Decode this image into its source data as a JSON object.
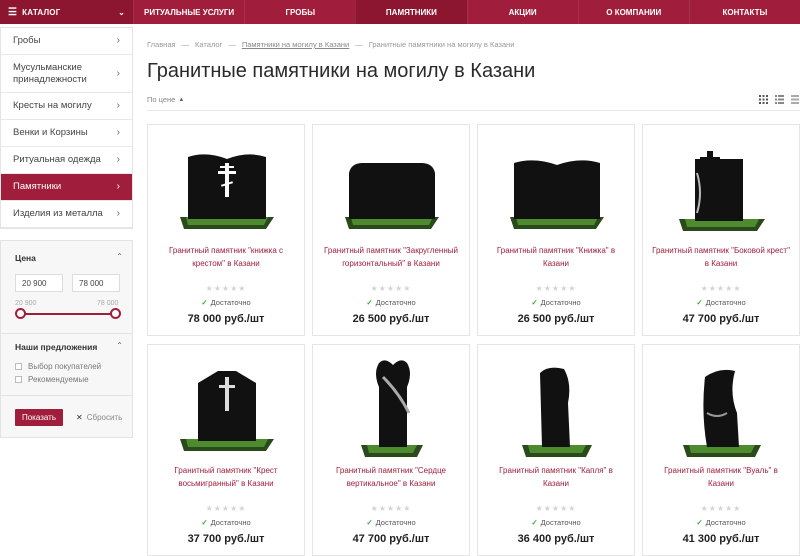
{
  "topbar": {
    "catalog_label": "КАТАЛОГ",
    "nav": [
      "РИТУАЛЬНЫЕ УСЛУГИ",
      "ГРОБЫ",
      "ПАМЯТНИКИ",
      "АКЦИИ",
      "О КОМПАНИИ",
      "КОНТАКТЫ"
    ],
    "active": "ПАМЯТНИКИ"
  },
  "sidebar": {
    "items": [
      "Гробы",
      "Мусульманские принадлежности",
      "Кресты на могилу",
      "Венки и Корзины",
      "Ритуальная одежда",
      "Памятники",
      "Изделия из металла"
    ],
    "active": "Памятники"
  },
  "filter": {
    "price_title": "Цена",
    "min_value": "20 900",
    "max_value": "78 000",
    "range_min": "20 900",
    "range_max": "78 000",
    "offers_title": "Наши предложения",
    "checkboxes": [
      "Выбор покупателей",
      "Рекомендуемые"
    ],
    "show_label": "Показать",
    "reset_label": "Сбросить"
  },
  "breadcrumb": [
    "Главная",
    "Каталог",
    "Памятники на могилу в Казани",
    "Гранитные памятники на могилу в Казани"
  ],
  "page_title": "Гранитные памятники на могилу в Казани",
  "sort_label": "По цене",
  "products": [
    {
      "name": "Гранитный памятник \"книжка с крестом\" в Казани",
      "stock": "Достаточно",
      "price": "78 000 руб./шт",
      "shape": "book-cross"
    },
    {
      "name": "Гранитный памятник \"Закругленный горизонтальный\" в Казани",
      "stock": "Достаточно",
      "price": "26 500 руб./шт",
      "shape": "rounded"
    },
    {
      "name": "Гранитный памятник \"Книжка\" в Казани",
      "stock": "Достаточно",
      "price": "26 500 руб./шт",
      "shape": "book"
    },
    {
      "name": "Гранитный памятник \"Боковой крест\" в Казани",
      "stock": "Достаточно",
      "price": "47 700 руб./шт",
      "shape": "side-cross"
    },
    {
      "name": "Гранитный памятник \"Крест восьмигранный\" в Казани",
      "stock": "Достаточно",
      "price": "37 700 руб./шт",
      "shape": "octagon"
    },
    {
      "name": "Гранитный памятник \"Сердце вертикальное\" в Казани",
      "stock": "Достаточно",
      "price": "47 700 руб./шт",
      "shape": "heart"
    },
    {
      "name": "Гранитный памятник \"Капля\" в Казани",
      "stock": "Достаточно",
      "price": "36 400 руб./шт",
      "shape": "drop"
    },
    {
      "name": "Гранитный памятник \"Вуаль\" в Казани",
      "stock": "Достаточно",
      "price": "41 300 руб./шт",
      "shape": "veil"
    }
  ],
  "colors": {
    "accent": "#a01e3c",
    "accent_dark": "#8c1530",
    "in_stock": "#3aa83a"
  }
}
